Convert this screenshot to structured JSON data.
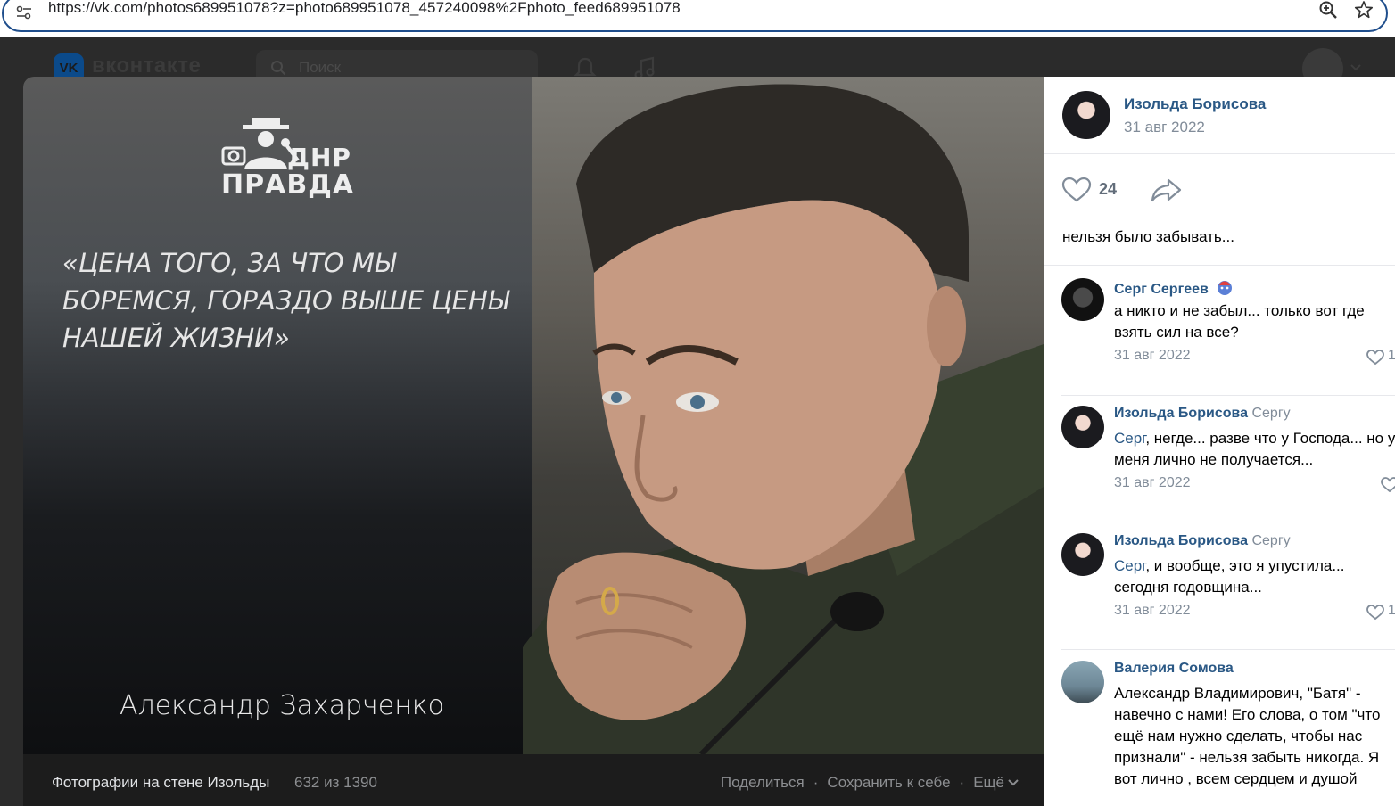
{
  "browser": {
    "url": "https://vk.com/photos689951078?z=photo689951078_457240098%2Fphoto_feed689951078"
  },
  "vk_header": {
    "logo": "VK",
    "brand": "вконтакте",
    "search_placeholder": "Поиск"
  },
  "photo": {
    "logo_line1": "ДНР",
    "logo_line2": "ПРАВДА",
    "quote": "«ЦЕНА ТОГО, ЗА ЧТО МЫ БОРЕМСЯ, ГОРАЗДО ВЫШЕ ЦЕНЫ НАШЕЙ ЖИЗНИ»",
    "author": "Александр Захарченко"
  },
  "viewer_footer": {
    "album_title": "Фотографии на стене Изольды",
    "album_count": "632 из 1390",
    "share": "Поделиться",
    "save": "Сохранить к себе",
    "more": "Ещё",
    "separator": "·"
  },
  "post": {
    "author": "Изольда Борисова",
    "date": "31 авг 2022",
    "likes": "24",
    "text": "нельзя было забывать..."
  },
  "comments": [
    {
      "author": "Серг Сергеев",
      "reply_to": "",
      "mention": "",
      "text": "а никто и не забыл... только вот где взять сил на все?",
      "date": "31 авг 2022",
      "likes": "1"
    },
    {
      "author": "Изольда Борисова",
      "reply_to": "Сергу",
      "mention": "Серг",
      "text": ", негде... разве что у Господа... но у меня лично не получается...",
      "date": "31 авг 2022",
      "likes": ""
    },
    {
      "author": "Изольда Борисова",
      "reply_to": "Сергу",
      "mention": "Серг",
      "text": ", и вообще, это я упустила... сегодня годовщина...",
      "date": "31 авг 2022",
      "likes": "1"
    },
    {
      "author": "Валерия Сомова",
      "reply_to": "",
      "mention": "",
      "text": "Александр Владимирович, \"Батя\" - навечно с нами! Его слова, о том \"что ещё нам нужно сделать, чтобы нас признали\" - нельзя забыть никогда. Я вот лично , всем сердцем и душой",
      "date": "",
      "likes": ""
    }
  ],
  "colors": {
    "link": "#2a5885",
    "muted": "#818c99",
    "url_border": "#1f4e8c"
  }
}
